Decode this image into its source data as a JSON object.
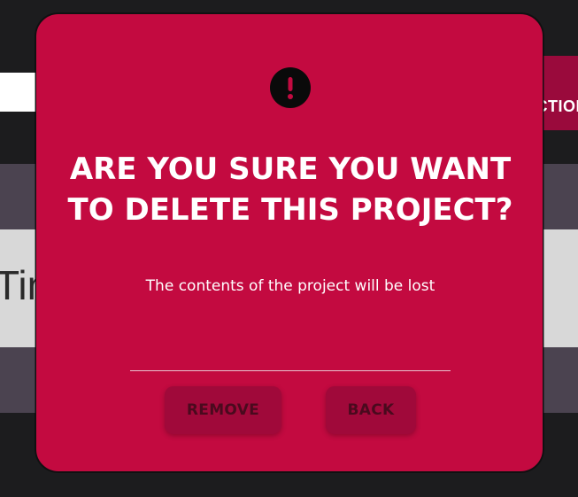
{
  "background": {
    "button_label": "ACTIONS",
    "heading_fragment": "Tim"
  },
  "dialog": {
    "icon": "exclamation-icon",
    "title_line_1": "ARE YOU SURE YOU WANT",
    "title_line_2": "TO DELETE THIS PROJECT?",
    "message": "The contents of the project will be lost",
    "remove_label": "REMOVE",
    "back_label": "BACK"
  },
  "colors": {
    "page_background": "#1c1c1e",
    "dialog_background": "#c30a40",
    "dialog_button": "#a0093a",
    "band_dark": "#4b4350",
    "band_light": "#d8d8d8",
    "text_on_dialog": "#ffffff"
  }
}
